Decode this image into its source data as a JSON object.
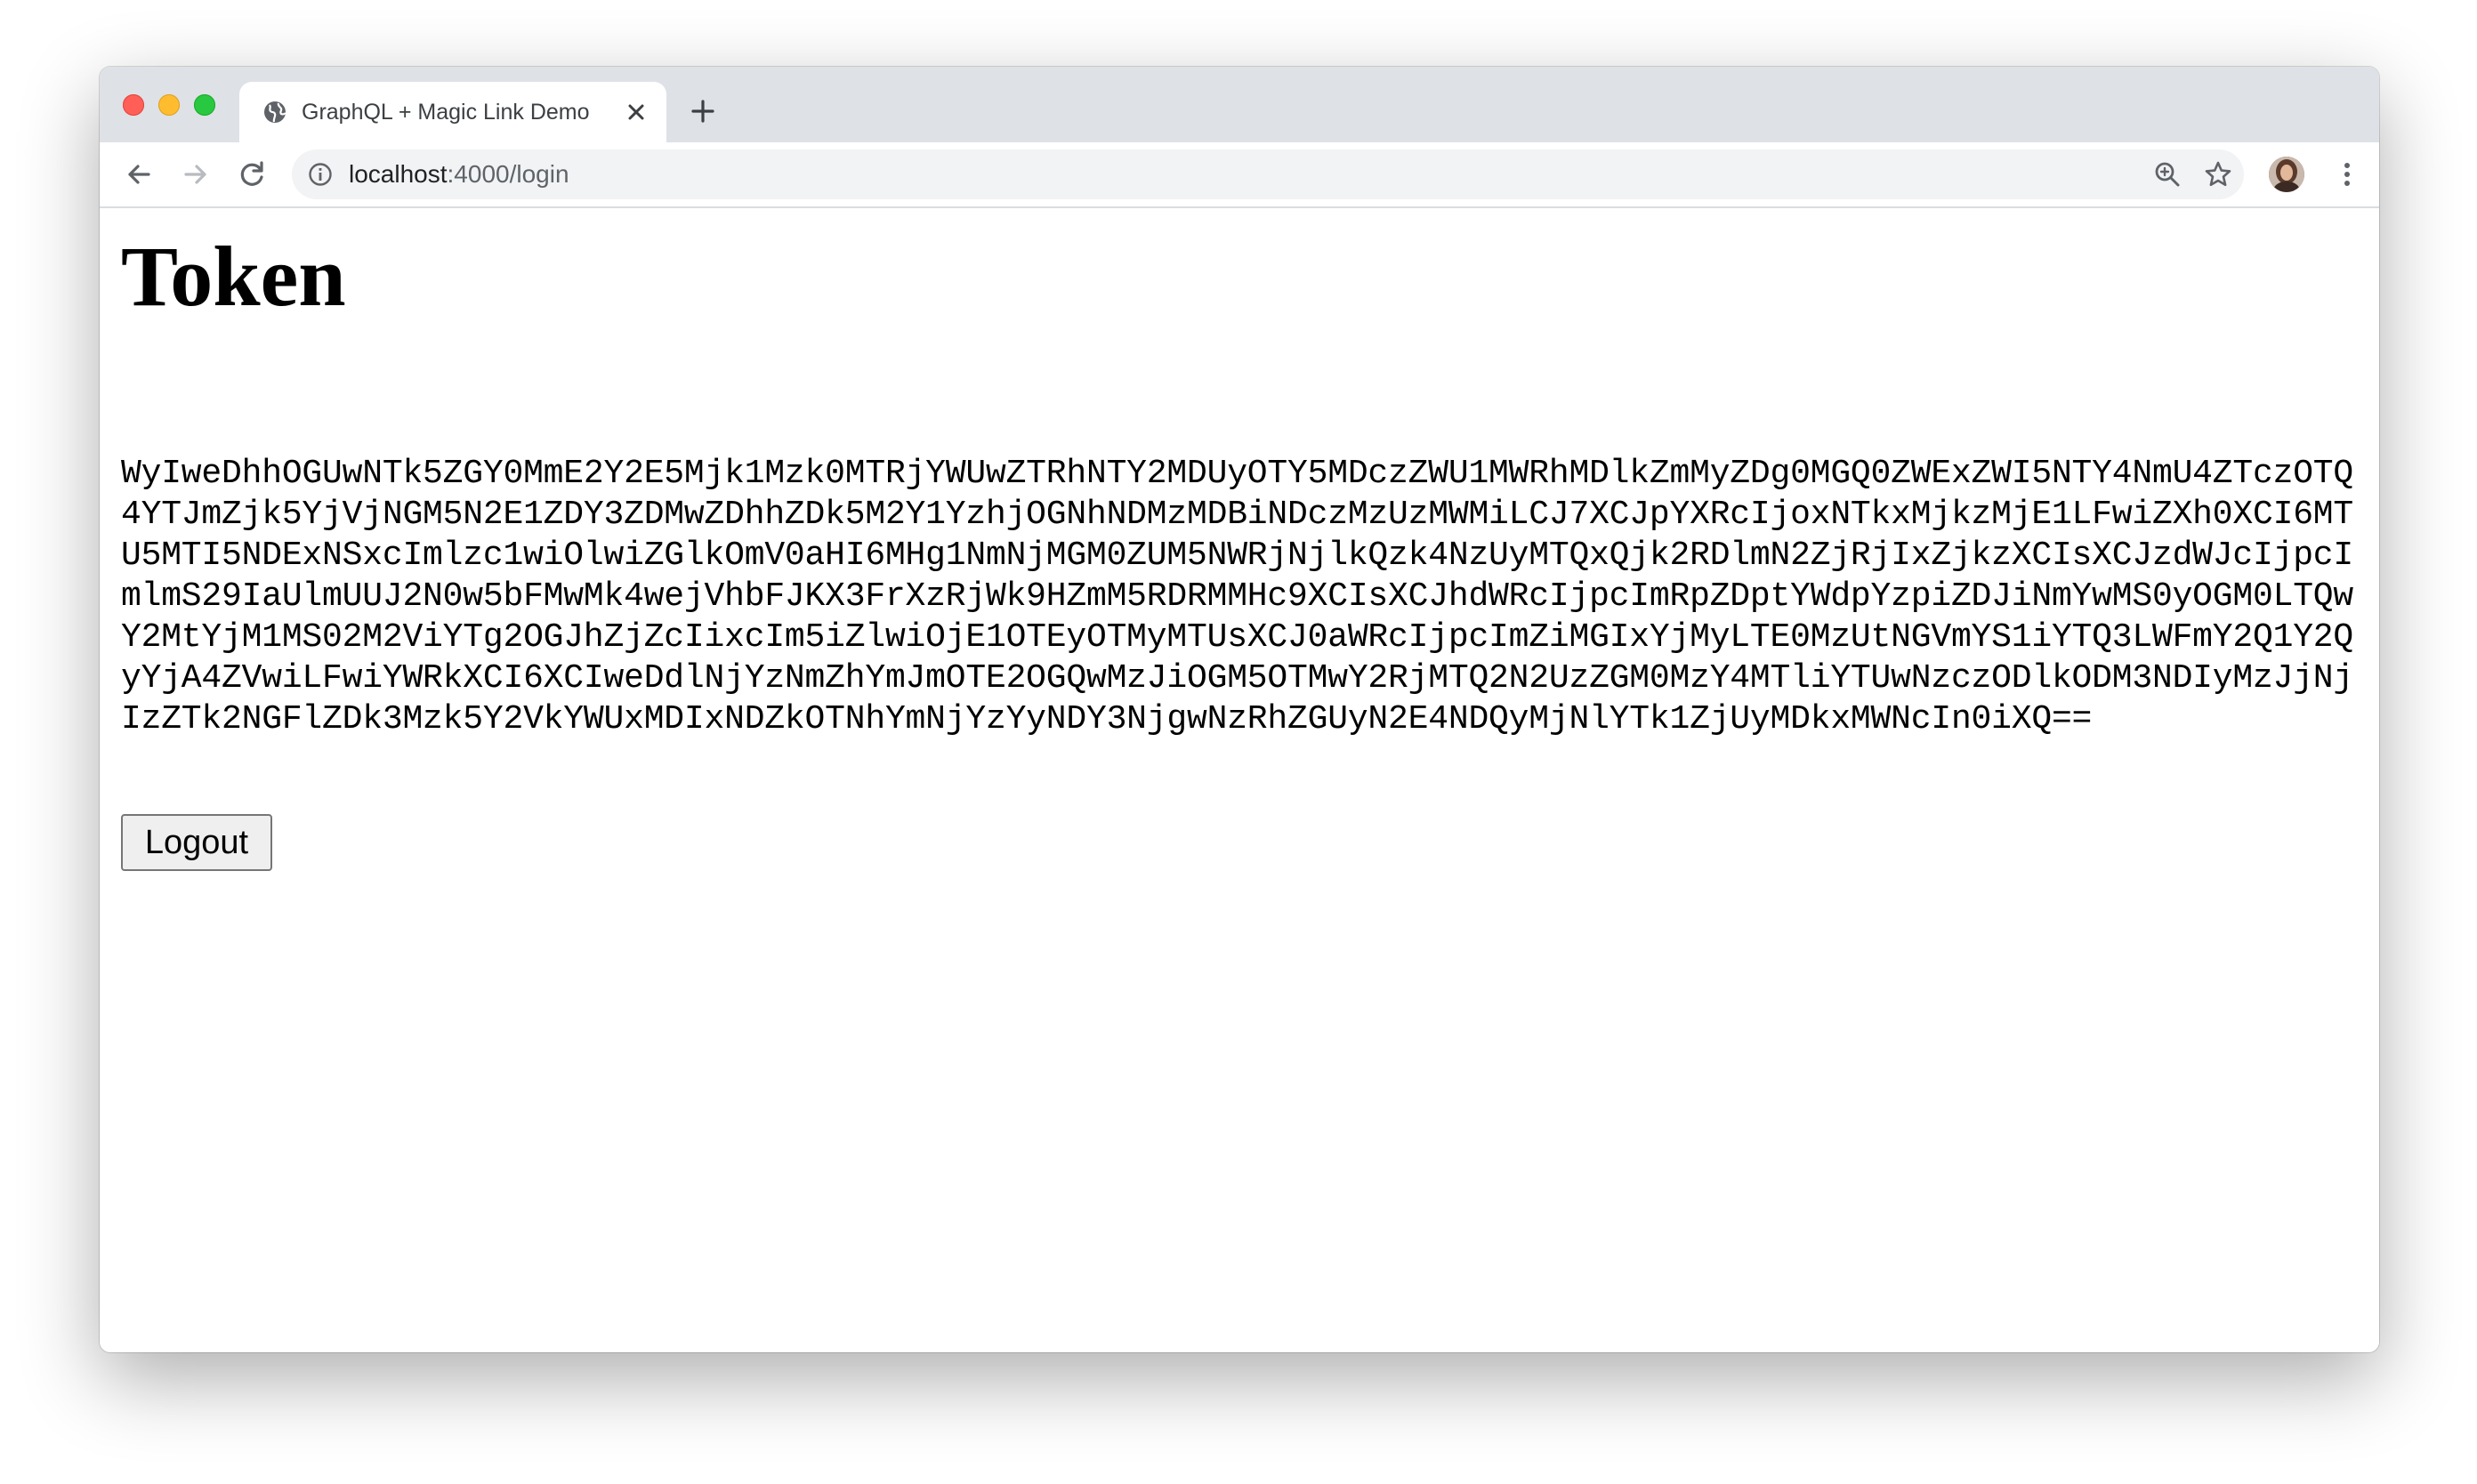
{
  "window": {
    "traffic_lights": [
      "close",
      "minimize",
      "zoom"
    ]
  },
  "tab": {
    "title": "GraphQL + Magic Link Demo",
    "favicon": "globe-icon",
    "close_icon": "close-icon"
  },
  "toolbar": {
    "new_tab_icon": "plus-icon",
    "back_icon": "arrow-left-icon",
    "forward_icon": "arrow-right-icon",
    "reload_icon": "reload-icon",
    "url_host": "localhost",
    "url_path": ":4000/login",
    "site_info_icon": "info-icon",
    "zoom_icon": "zoom-icon",
    "bookmark_icon": "star-icon",
    "menu_icon": "kebab-menu-icon"
  },
  "page": {
    "heading": "Token",
    "token": "WyIweDhhOGUwNTk5ZGY0MmE2Y2E5Mjk1Mzk0MTRjYWUwZTRhNTY2MDUyOTY5MDczZWU1MWRhMDlkZmMyZDg0MGQ0ZWExZWI5NTY4NmU4ZTczOTQ4YTJmZjk5YjVjNGM5N2E1ZDY3ZDMwZDhhZDk5M2Y1YzhjOGNhNDMzMDBiNDczMzUzMWMiLCJ7XCJpYXRcIjoxNTkxMjkzMjE1LFwiZXh0XCI6MTU5MTI5NDExNSxcImlzc1wiOlwiZGlkOmV0aHI6MHg1NmNjMGM0ZUM5NWRjNjlkQzk4NzUyMTQxQjk2RDlmN2ZjRjIxZjkzXCIsXCJzdWJcIjpcImlmS29IaUlmUUJ2N0w5bFMwMk4wejVhbFJKX3FrXzRjWk9HZmM5RDRMMHc9XCIsXCJhdWRcIjpcImRpZDptYWdpYzpiZDJiNmYwMS0yOGM0LTQwY2MtYjM1MS02M2ViYTg2OGJhZjZcIixcIm5iZlwiOjE1OTEyOTMyMTUsXCJ0aWRcIjpcImZiMGIxYjMyLTE0MzUtNGVmYS1iYTQ3LWFmY2Q1Y2QyYjA4ZVwiLFwiYWRkXCI6XCIweDdlNjYzNmZhYmJmOTE2OGQwMzJiOGM5OTMwY2RjMTQ2N2UzZGM0MzY4MTliYTUwNzczODlkODM3NDIyMzJjNjIzZTk2NGFlZDk3Mzk5Y2VkYWUxMDIxNDZkOTNhYmNjYzYyNDY3NjgwNzRhZGUyN2E4NDQyMjNlYTk1ZjUyMDkxMWNcIn0iXQ==",
    "logout_label": "Logout"
  },
  "user": {
    "avatar_icon": "avatar"
  },
  "colors": {
    "titlebar": "#dee1e6",
    "omnibox": "#f1f3f4",
    "traffic_red": "#ff5f57",
    "traffic_yellow": "#febc2e",
    "traffic_green": "#28c840"
  }
}
